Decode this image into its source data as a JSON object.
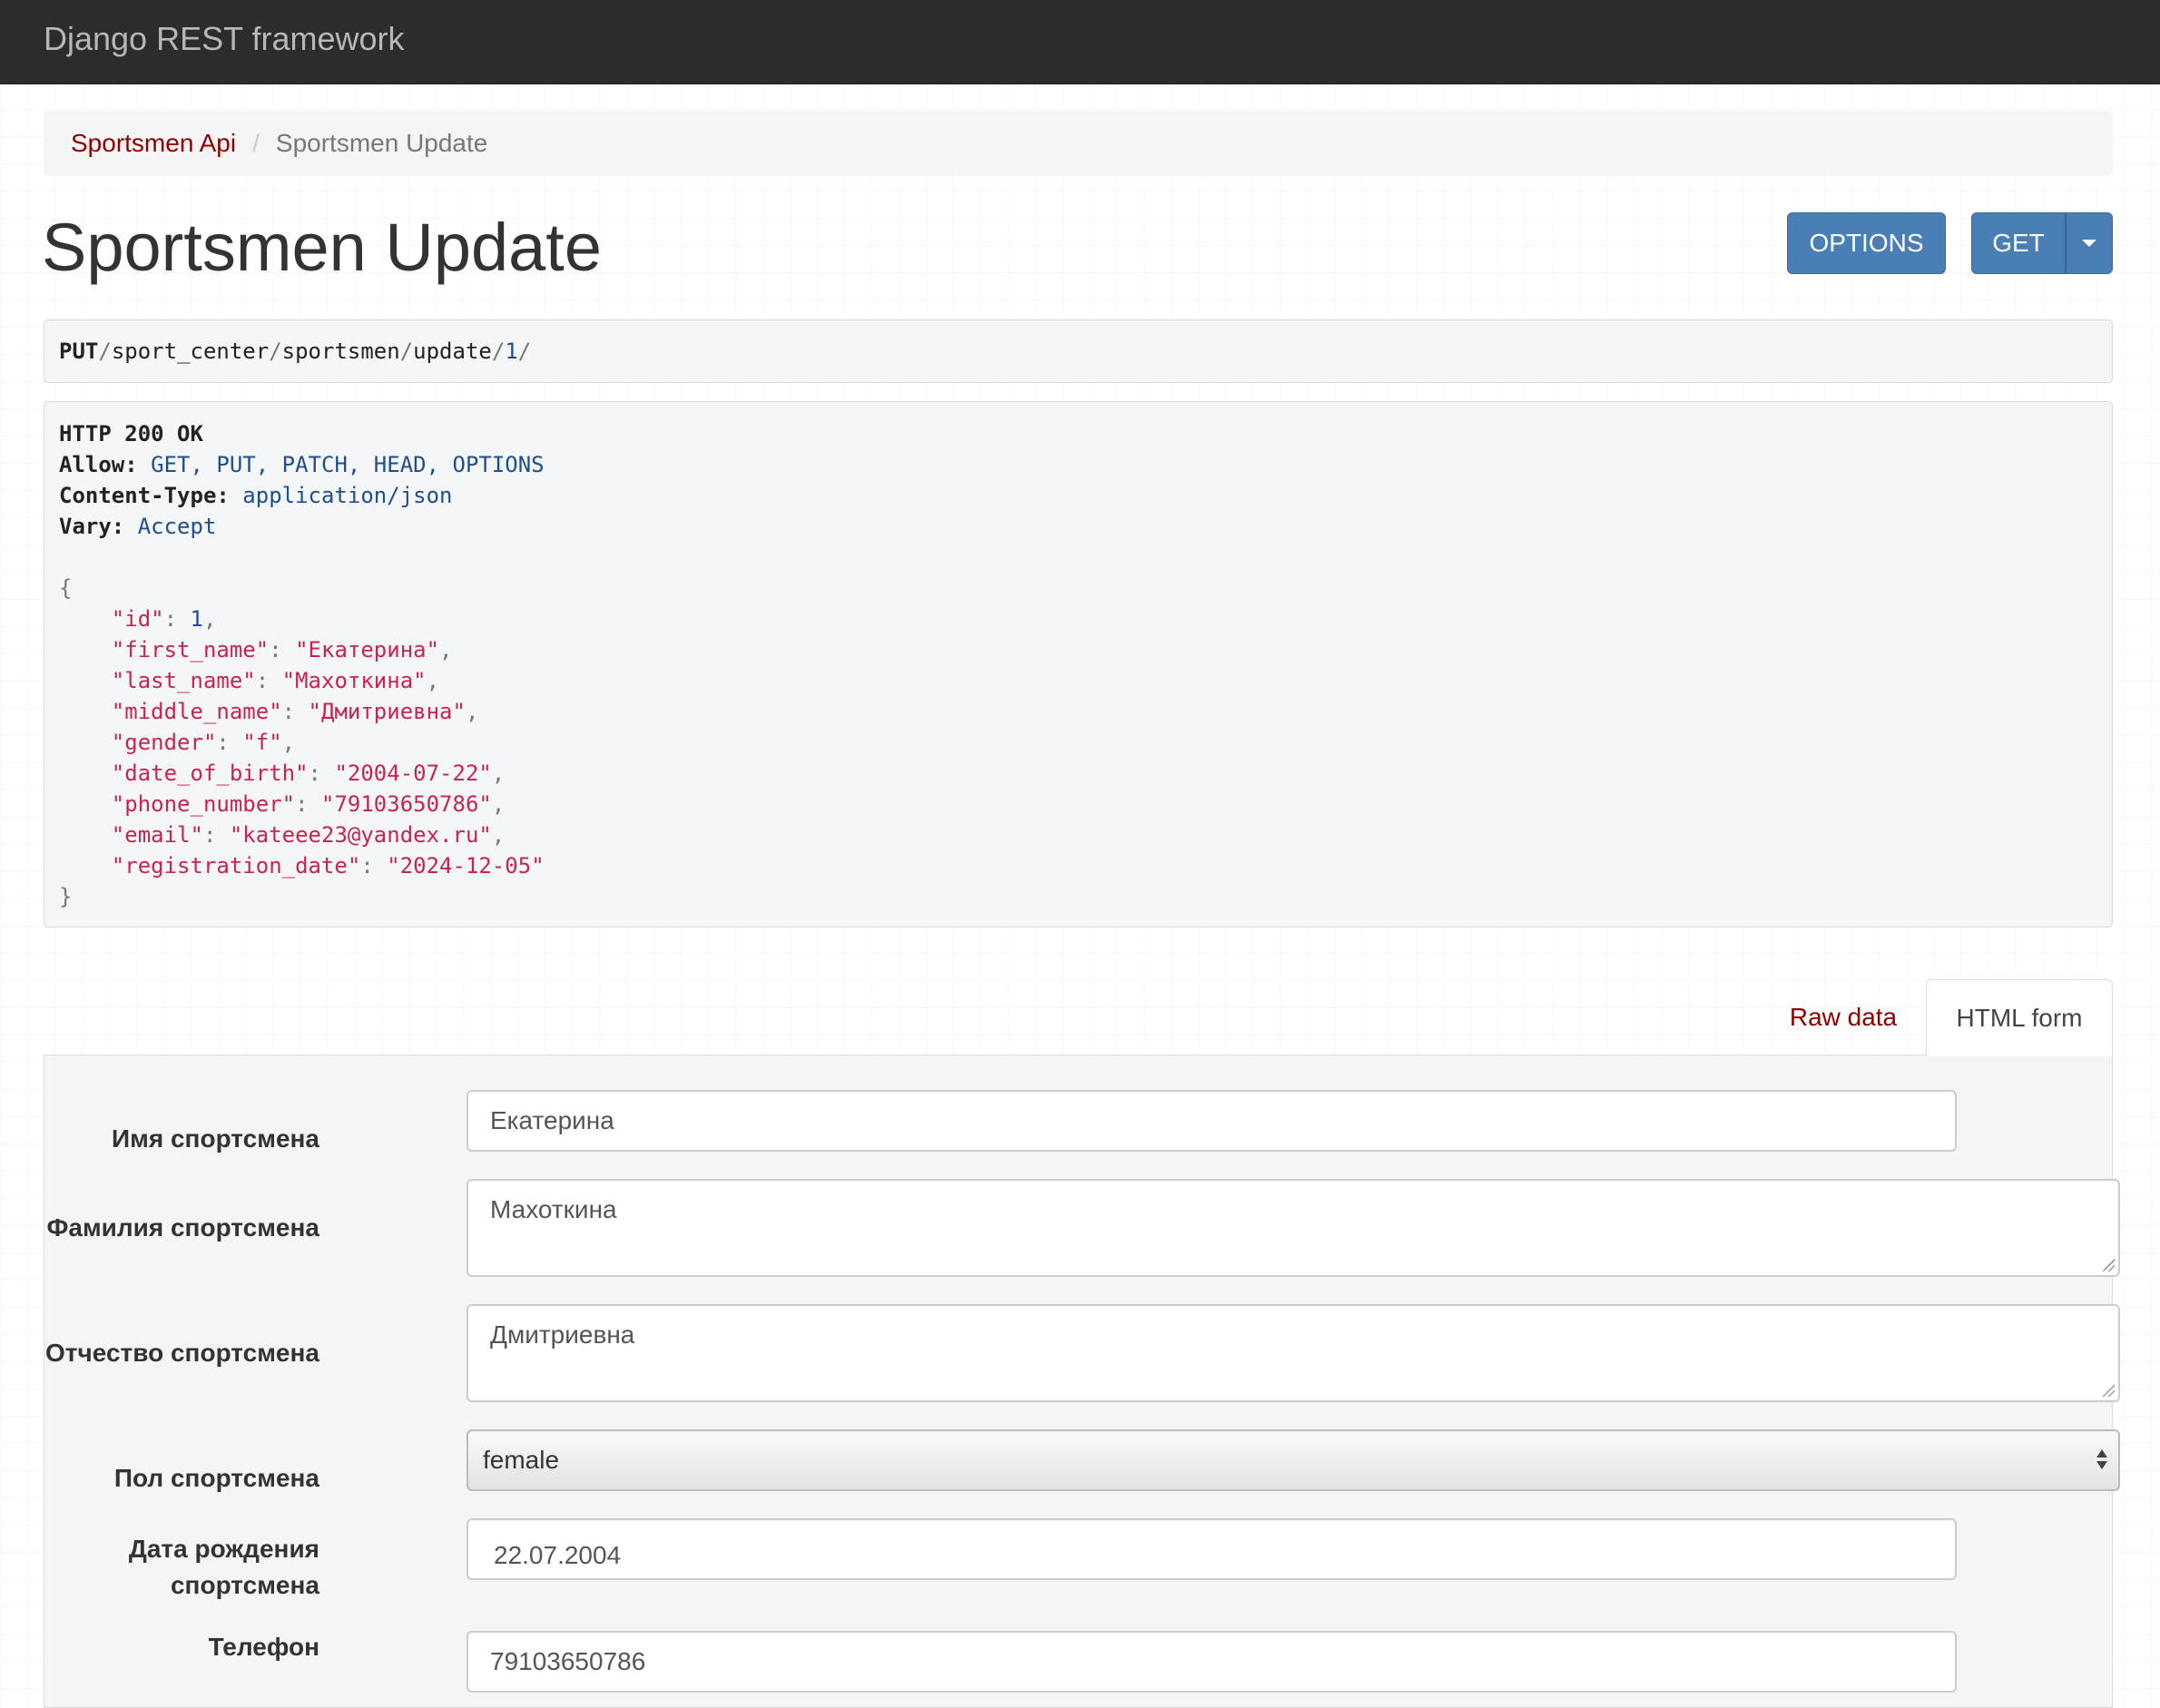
{
  "navbar": {
    "brand": "Django REST framework"
  },
  "breadcrumb": {
    "items": [
      "Sportsmen Api",
      "Sportsmen Update"
    ],
    "separator": "/"
  },
  "page": {
    "title": "Sportsmen Update"
  },
  "actions": {
    "options_label": "OPTIONS",
    "get_label": "GET"
  },
  "request": {
    "method": "PUT",
    "path_segments": [
      "sport_center",
      "sportsmen",
      "update",
      "1"
    ]
  },
  "response": {
    "status_line": "HTTP 200 OK",
    "headers": [
      {
        "key": "Allow",
        "value": "GET, PUT, PATCH, HEAD, OPTIONS"
      },
      {
        "key": "Content-Type",
        "value": "application/json"
      },
      {
        "key": "Vary",
        "value": "Accept"
      }
    ],
    "body": [
      {
        "key": "id",
        "value": "1",
        "type": "number"
      },
      {
        "key": "first_name",
        "value": "Екатерина",
        "type": "string"
      },
      {
        "key": "last_name",
        "value": "Махоткина",
        "type": "string"
      },
      {
        "key": "middle_name",
        "value": "Дмитриевна",
        "type": "string"
      },
      {
        "key": "gender",
        "value": "f",
        "type": "string"
      },
      {
        "key": "date_of_birth",
        "value": "2004-07-22",
        "type": "string"
      },
      {
        "key": "phone_number",
        "value": "79103650786",
        "type": "string"
      },
      {
        "key": "email",
        "value": "kateee23@yandex.ru",
        "type": "string"
      },
      {
        "key": "registration_date",
        "value": "2024-12-05",
        "type": "string"
      }
    ]
  },
  "tabs": {
    "raw_label": "Raw data",
    "html_label": "HTML form"
  },
  "form": {
    "first_name_label": "Имя спортсмена",
    "first_name_value": "Екатерина",
    "last_name_label": "Фамилия спортсмена",
    "last_name_value": "Махоткина",
    "middle_name_label": "Отчество спортсмена",
    "middle_name_value": "Дмитриевна",
    "gender_label": "Пол спортсмена",
    "gender_value": "female",
    "dob_label_line1": "Дата рождения",
    "dob_label_line2": "спортсмена",
    "dob_value": "22.07.2004",
    "phone_label": "Телефон",
    "phone_value": "79103650786"
  },
  "colors": {
    "navbar_bg": "#2c2c2c",
    "link_red": "#8b0000",
    "button_blue": "#4a7fb5",
    "json_string": "#c7254e",
    "json_number": "#1f4e8c"
  }
}
